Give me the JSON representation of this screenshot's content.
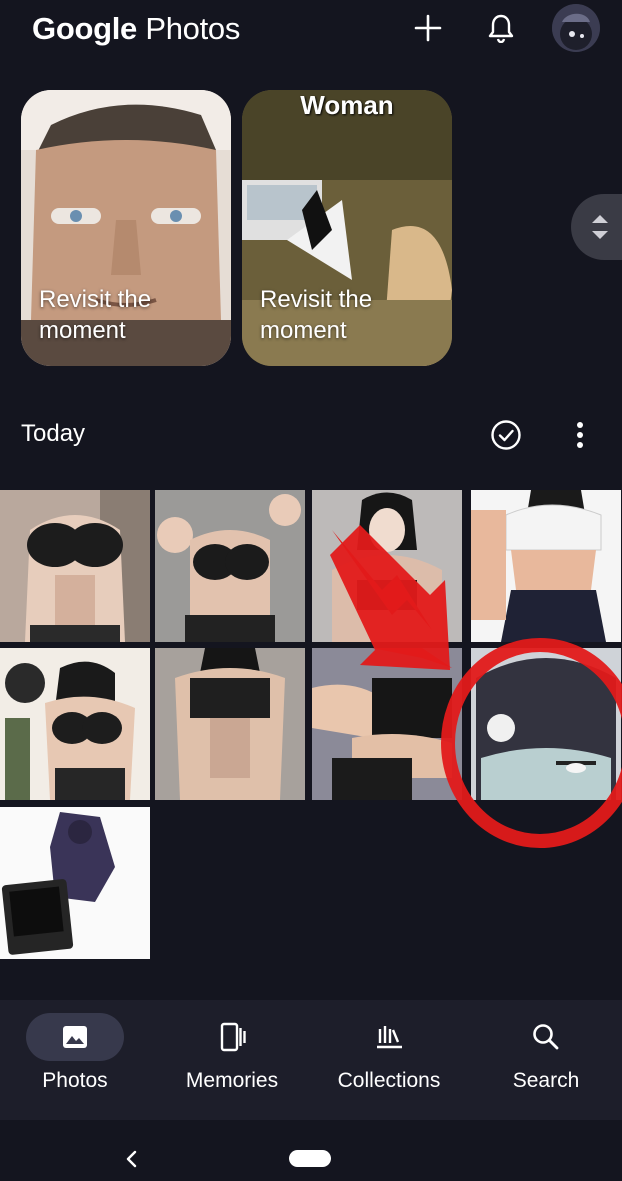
{
  "header": {
    "title_prefix": "Google",
    "title_suffix": "Photos",
    "add_icon": "plus-icon",
    "notifications_icon": "bell-icon",
    "avatar_icon": "account-avatar"
  },
  "memories": [
    {
      "caption": "Revisit the moment",
      "top_text": ""
    },
    {
      "caption": "Revisit the moment",
      "top_text": "Woman"
    }
  ],
  "section": {
    "title": "Today",
    "select_icon": "check-circle-icon",
    "more_icon": "more-vert-icon"
  },
  "photos_count": 9,
  "bottom_nav": [
    {
      "label": "Photos",
      "icon": "photo-icon",
      "active": true
    },
    {
      "label": "Memories",
      "icon": "memories-icon",
      "active": false
    },
    {
      "label": "Collections",
      "icon": "collections-icon",
      "active": false
    },
    {
      "label": "Search",
      "icon": "search-icon",
      "active": false
    }
  ],
  "colors": {
    "background": "#14151f",
    "nav_background": "#1d1e2a",
    "active_pill": "#37394c"
  }
}
